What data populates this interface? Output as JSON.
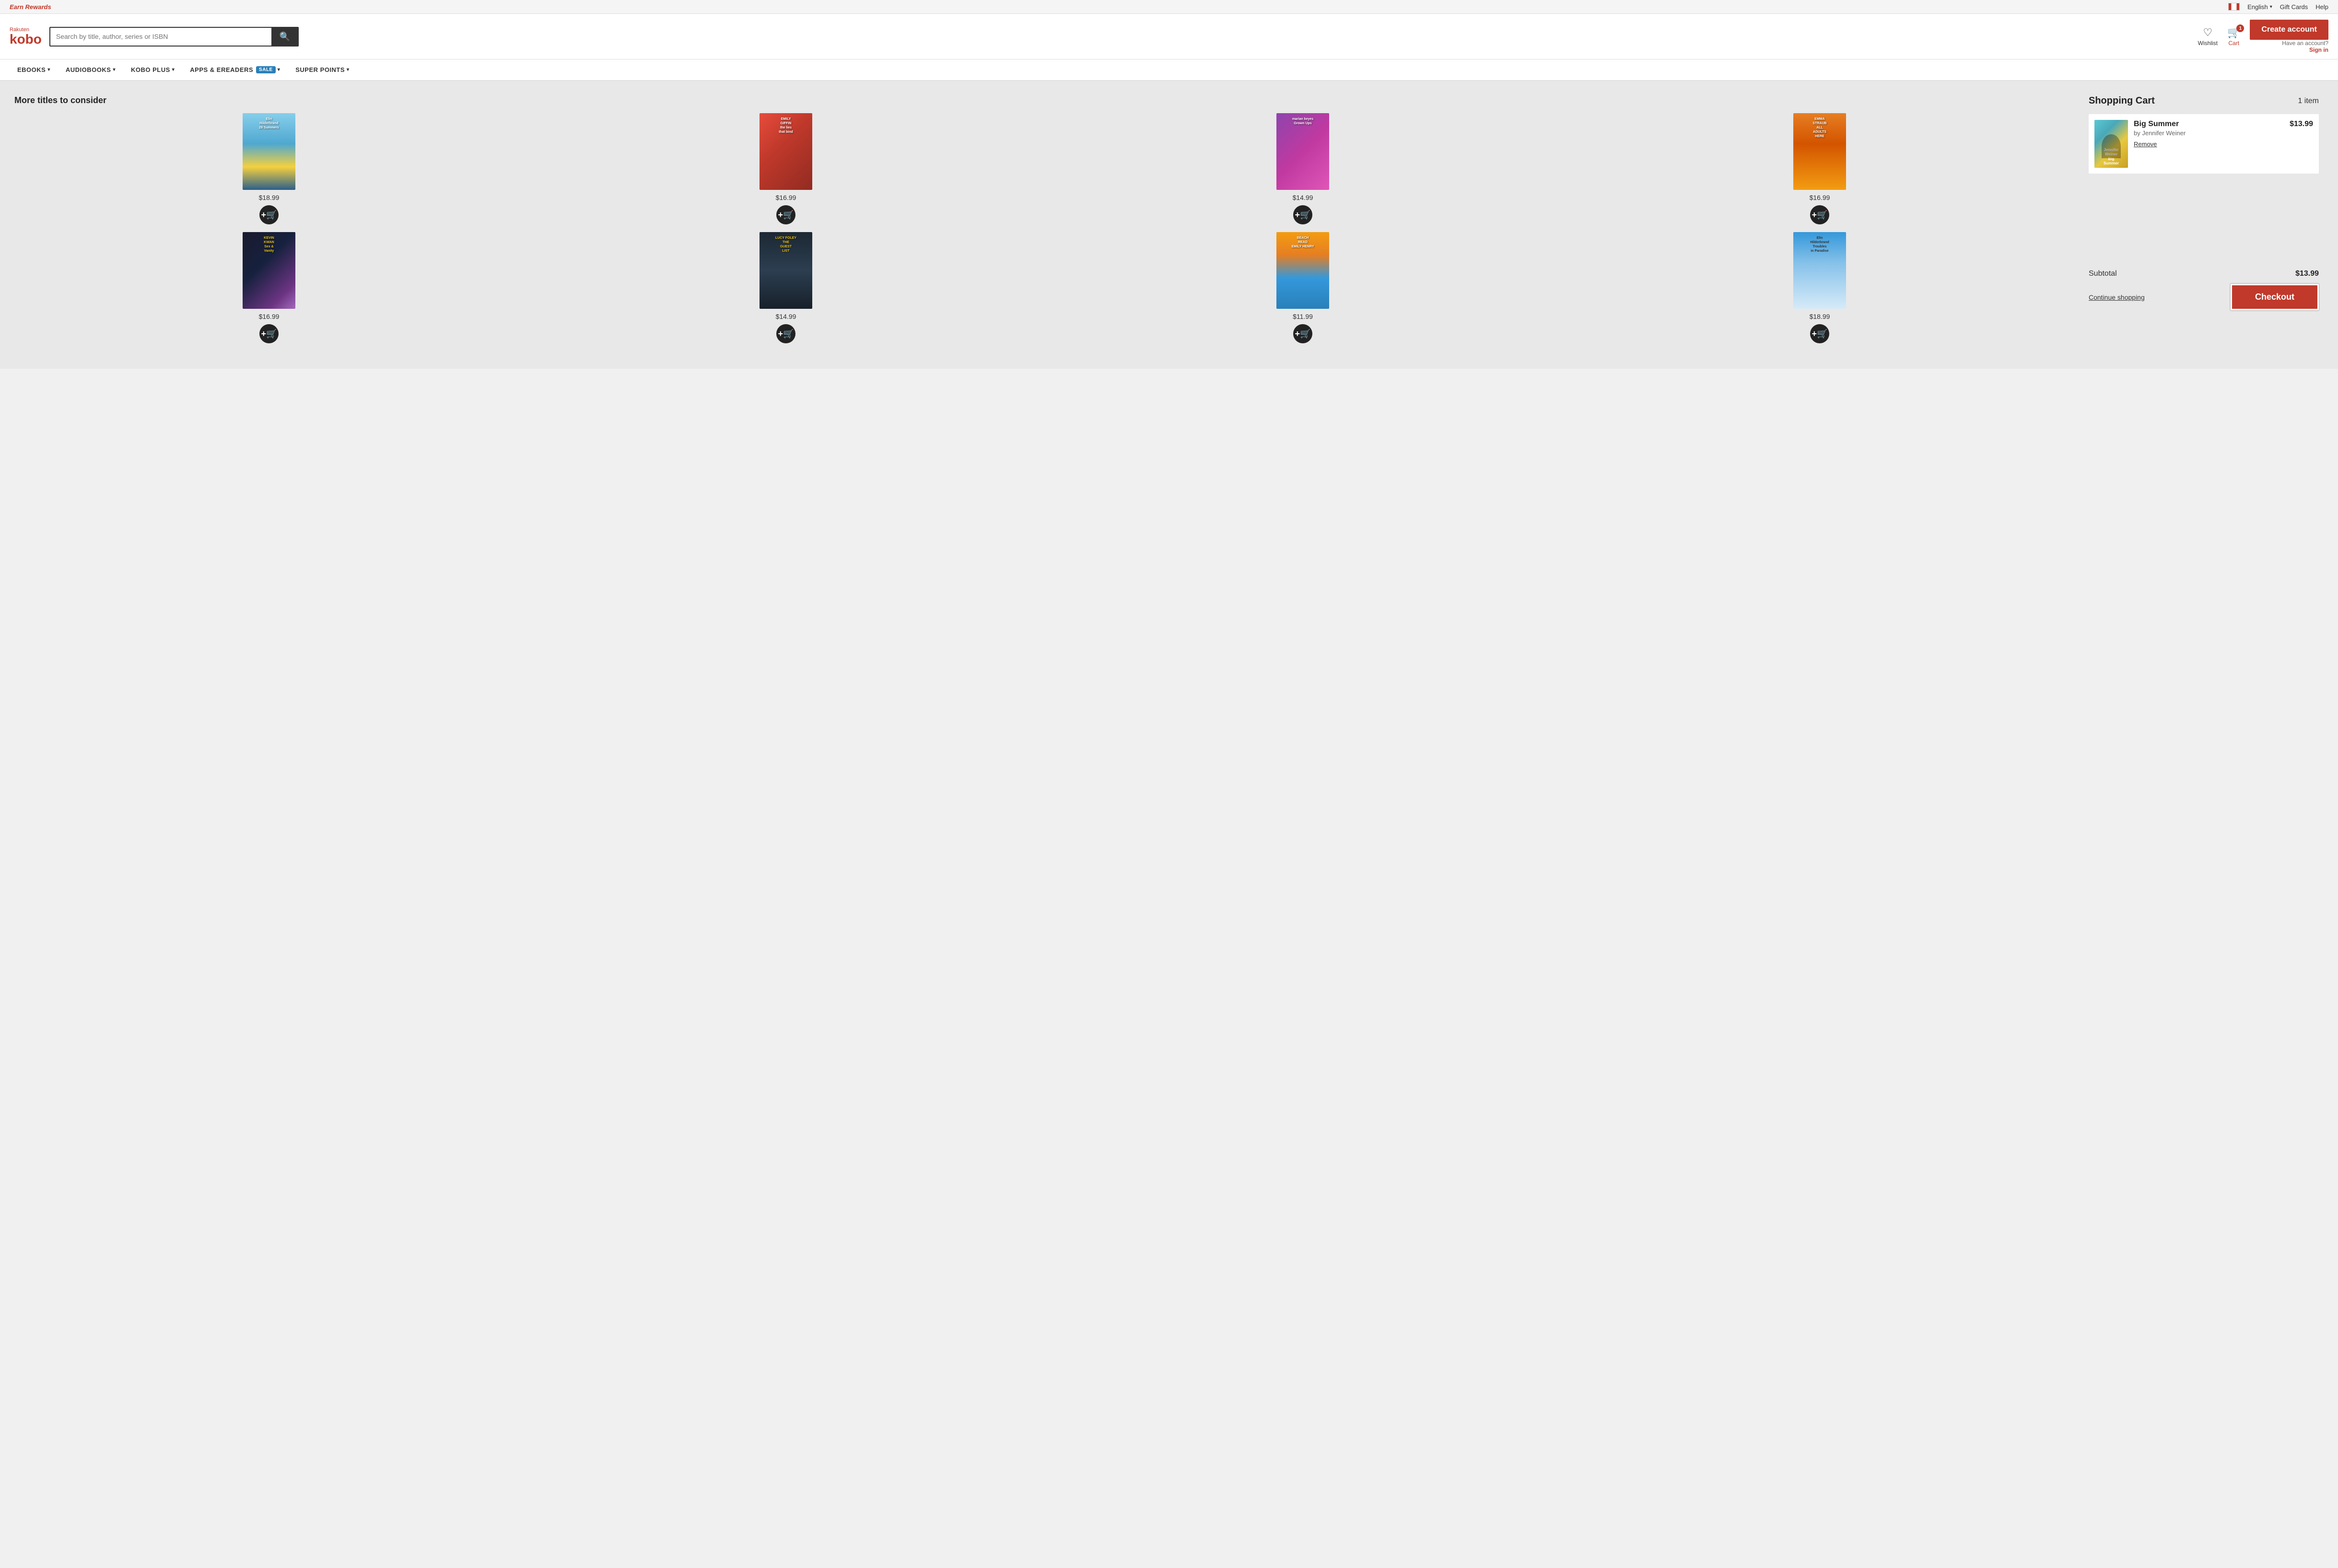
{
  "promoBar": {
    "earnRewards": "Earn Rewards",
    "language": "English",
    "giftCards": "Gift Cards",
    "help": "Help"
  },
  "header": {
    "logoRakuten": "Rakuten",
    "logoKobo": "kobo",
    "searchPlaceholder": "Search by title, author, series or ISBN",
    "wishlistLabel": "Wishlist",
    "cartLabel": "Cart",
    "cartCount": "1",
    "createAccountLabel": "Create account",
    "signInText": "Have an account?",
    "signInLink": "Sign in"
  },
  "nav": {
    "items": [
      {
        "label": "eBOOKS",
        "hasDropdown": true
      },
      {
        "label": "AUDIOBOOKS",
        "hasDropdown": true
      },
      {
        "label": "KOBO PLUS",
        "hasDropdown": true
      },
      {
        "label": "APPS & eREADERS",
        "hasDropdown": true,
        "hasSale": true
      },
      {
        "label": "SUPER POINTS",
        "hasDropdown": true
      }
    ]
  },
  "suggestions": {
    "title": "More titles to consider",
    "books": [
      {
        "id": "28summers",
        "title": "28 Summers",
        "author": "Elin Hilderbrand",
        "price": "$18.99",
        "coverText": "Elin\nHilderbrand\n28 Summers"
      },
      {
        "id": "lies-that-bind",
        "title": "The Lies That Bind",
        "author": "Emily Giffin",
        "price": "$16.99",
        "coverText": "EMILY\nGIFFIN\nthe lies\nthat bind"
      },
      {
        "id": "grown-ups",
        "title": "Grown Ups",
        "author": "Marian Keyes",
        "price": "$14.99",
        "coverText": "marian keyes\nGrown Ups"
      },
      {
        "id": "all-adults-here",
        "title": "All Adults Here",
        "author": "Emma Straub",
        "price": "$16.99",
        "coverText": "EMMA\nSTRAUB\nALL\nADULTS\nHERE"
      },
      {
        "id": "sex-and-vanity",
        "title": "Sex and Vanity",
        "author": "Kevin Kwan",
        "price": "$16.99",
        "coverText": "KEVIN\nKWAN\nSex &\nVanity"
      },
      {
        "id": "guest-list",
        "title": "The Guest List",
        "author": "Lucy Foley",
        "price": "$14.99",
        "coverText": "LUCY FOLEY\nTHE\nGUEST\nLIST"
      },
      {
        "id": "beach-read",
        "title": "Beach Read",
        "author": "Emily Henry",
        "price": "$11.99",
        "coverText": "BEACH\nREAD\nEMILY HENRY"
      },
      {
        "id": "troubles-paradise",
        "title": "Troubles in Paradise",
        "author": "Elin Hilderbrand",
        "price": "$18.99",
        "coverText": "Elin\nHilderbrand\nTroubles\nin Paradise"
      }
    ]
  },
  "cart": {
    "title": "Shopping Cart",
    "itemCount": "1 item",
    "item": {
      "title": "Big Summer",
      "author": "by Jennifer Weiner",
      "price": "$13.99",
      "removeLabel": "Remove"
    },
    "subtotalLabel": "Subtotal",
    "subtotalAmount": "$13.99",
    "continueShoppingLabel": "Continue shopping",
    "checkoutLabel": "Checkout"
  }
}
